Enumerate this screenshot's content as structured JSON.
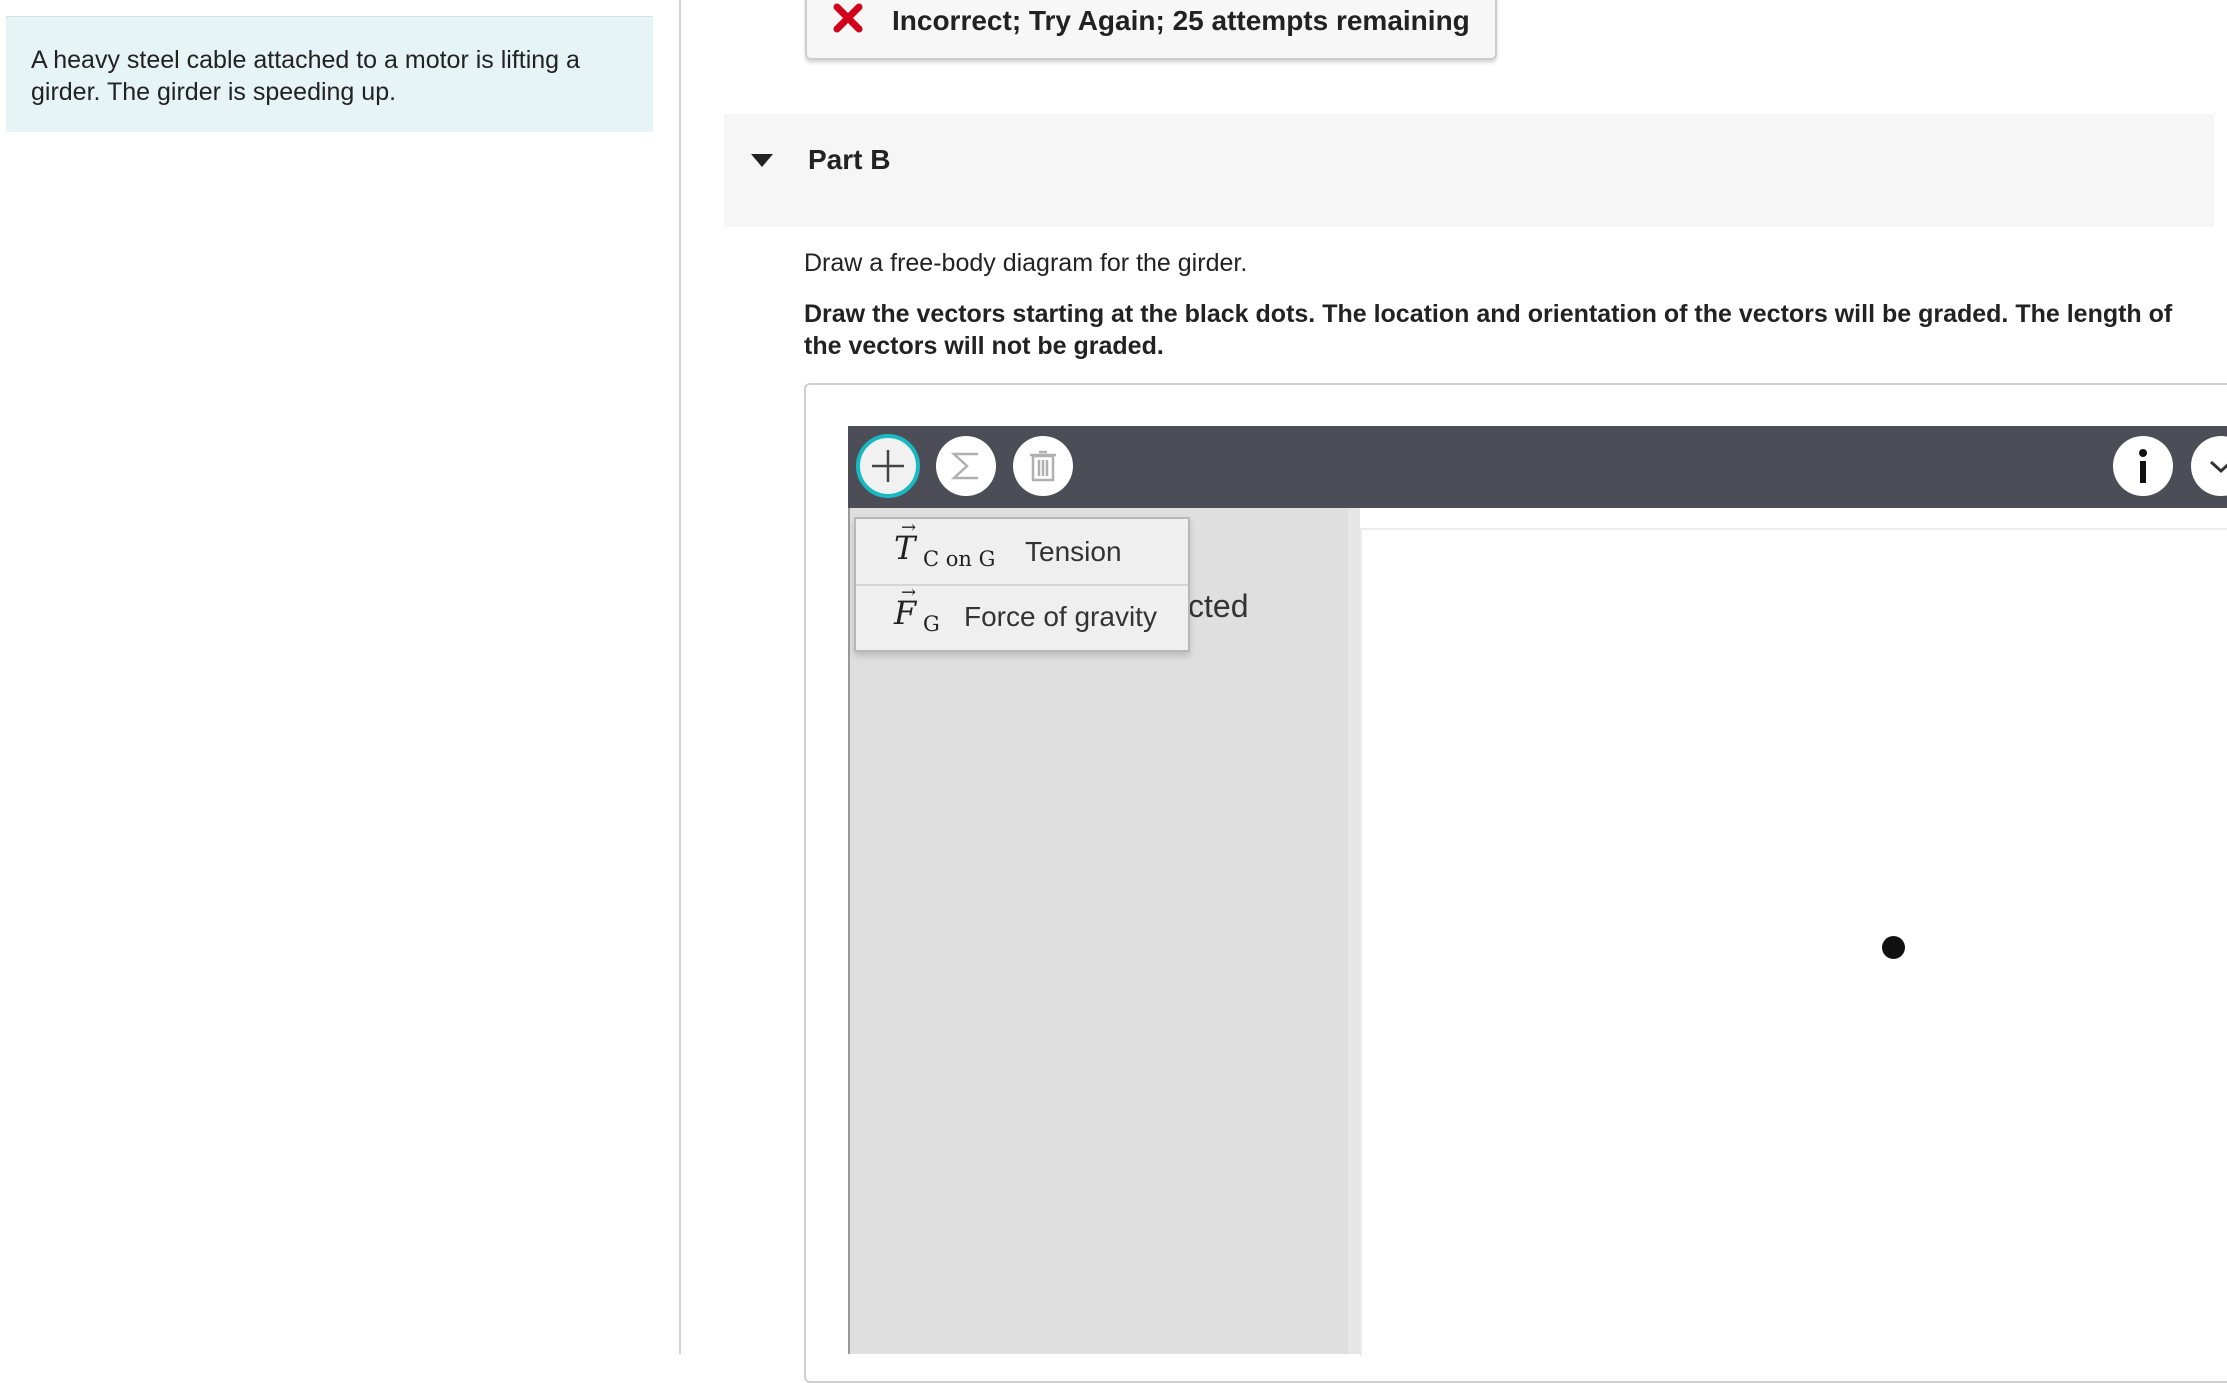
{
  "problem": {
    "text": "A heavy steel cable attached to a motor is lifting a girder. The girder is speeding up."
  },
  "feedback": {
    "message": "Incorrect; Try Again; 25 attempts remaining",
    "icon": "x-icon",
    "color": "#d0021b"
  },
  "part": {
    "title": "Part B",
    "instruction": "Draw a free-body diagram for the girder.",
    "bold_instruction": "Draw the vectors starting at the black dots. The location and orientation of the vectors will be graded. The length of the vectors will not be graded."
  },
  "toolbar": {
    "buttons": [
      "plus-icon",
      "sigma-icon",
      "trash-icon",
      "info-icon",
      "chevron-down-icon"
    ],
    "accent": "#19b9c4"
  },
  "canvas": {
    "partial_label": "cted"
  },
  "menu": {
    "items": [
      {
        "symbol": "T",
        "subscript": "C on G",
        "label": "Tension"
      },
      {
        "symbol": "F",
        "subscript": "G",
        "label": "Force of gravity"
      }
    ]
  }
}
